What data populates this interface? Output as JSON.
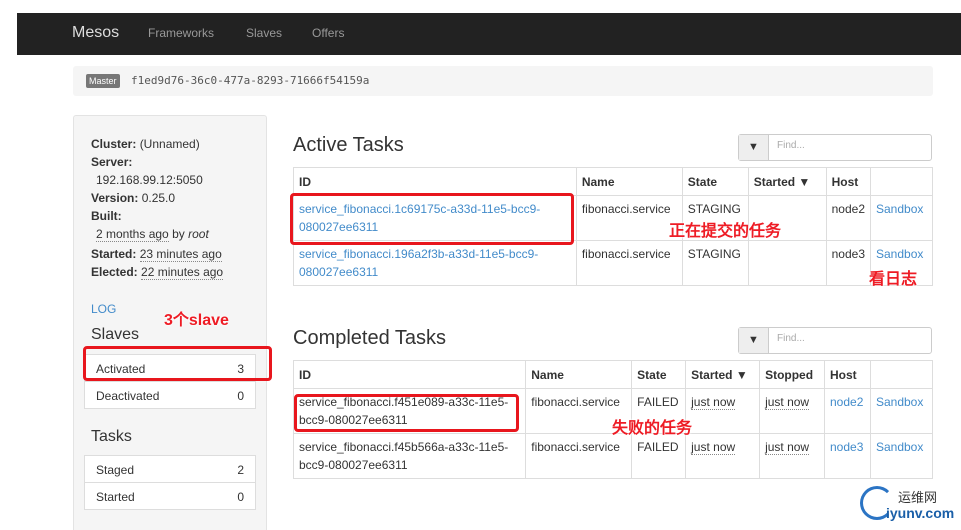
{
  "nav": {
    "brand": "Mesos",
    "links": [
      "Frameworks",
      "Slaves",
      "Offers"
    ]
  },
  "master": {
    "badge": "Master",
    "id": "f1ed9d76-36c0-477a-8293-71666f54159a"
  },
  "sidebar": {
    "cluster_label": "Cluster:",
    "cluster_value": "(Unnamed)",
    "server_label": "Server:",
    "server_value": "192.168.99.12:5050",
    "version_label": "Version:",
    "version_value": "0.25.0",
    "built_label": "Built:",
    "built_ago": "2 months ago",
    "built_by": "by",
    "built_user": "root",
    "started_label": "Started:",
    "started_value": "23 minutes ago",
    "elected_label": "Elected:",
    "elected_value": "22 minutes ago",
    "log_link": "LOG",
    "slaves_heading": "Slaves",
    "slaves": [
      {
        "label": "Activated",
        "value": "3"
      },
      {
        "label": "Deactivated",
        "value": "0"
      }
    ],
    "tasks_heading": "Tasks",
    "tasks": [
      {
        "label": "Staged",
        "value": "2"
      },
      {
        "label": "Started",
        "value": "0"
      }
    ]
  },
  "active": {
    "title": "Active Tasks",
    "filter_icon": "filter-icon",
    "filter_placeholder": "Find...",
    "headers": [
      "ID",
      "Name",
      "State",
      "Started ▼",
      "Host",
      ""
    ],
    "rows": [
      {
        "id": "service_fibonacci.1c69175c-a33d-11e5-bcc9-080027ee6311",
        "name": "fibonacci.service",
        "state": "STAGING",
        "started": "",
        "host": "node2",
        "sandbox": "Sandbox"
      },
      {
        "id": "service_fibonacci.196a2f3b-a33d-11e5-bcc9-080027ee6311",
        "name": "fibonacci.service",
        "state": "STAGING",
        "started": "",
        "host": "node3",
        "sandbox": "Sandbox"
      }
    ]
  },
  "completed": {
    "title": "Completed Tasks",
    "filter_icon": "filter-icon",
    "filter_placeholder": "Find...",
    "headers": [
      "ID",
      "Name",
      "State",
      "Started ▼",
      "Stopped",
      "Host",
      ""
    ],
    "rows": [
      {
        "id": "service_fibonacci.f451e089-a33c-11e5-bcc9-080027ee6311",
        "name": "fibonacci.service",
        "state": "FAILED",
        "started": "just now",
        "stopped": "just now",
        "host": "node2",
        "sandbox": "Sandbox"
      },
      {
        "id": "service_fibonacci.f45b566a-a33c-11e5-bcc9-080027ee6311",
        "name": "fibonacci.service",
        "state": "FAILED",
        "started": "just now",
        "stopped": "just now",
        "host": "node3",
        "sandbox": "Sandbox"
      }
    ]
  },
  "annotations": {
    "submitting_tasks": "正在提交的任务",
    "view_logs": "看日志",
    "three_slaves": "3个slave",
    "failed_tasks": "失败的任务"
  },
  "watermark": {
    "cn": "运维网",
    "en": "iyunv.com"
  },
  "colors": {
    "navbar": "#222222",
    "link": "#428bca",
    "annotation_red": "#e8161d"
  }
}
